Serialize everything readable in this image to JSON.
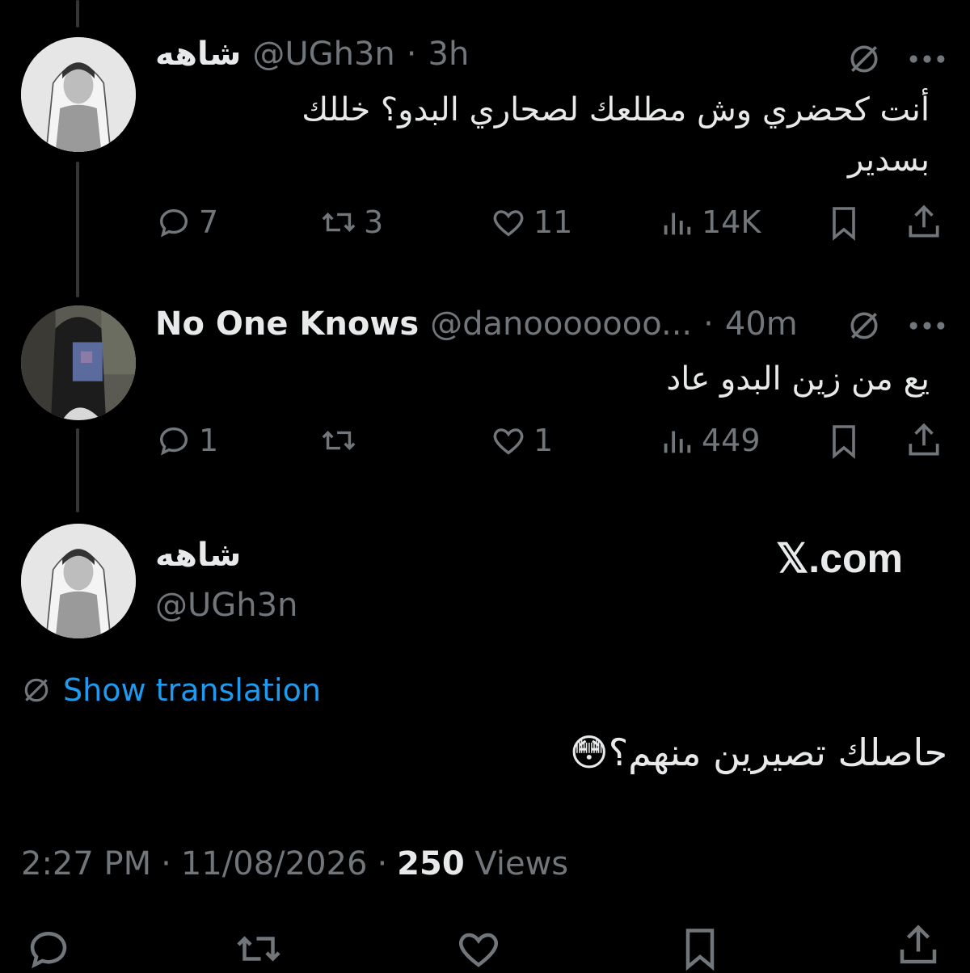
{
  "tweets": [
    {
      "name": "شاهه",
      "handle": "@UGh3n",
      "time": "3h",
      "text": "أنت كحضري وش مطلعك لصحاري البدو؟ خللك بسدير",
      "replies": "7",
      "retweets": "3",
      "likes": "11",
      "views": "14K"
    },
    {
      "name": "No One Knows",
      "handle": "@danooooooo...",
      "time": "40m",
      "text": "يع من زين البدو عاد",
      "replies": "1",
      "retweets": "",
      "likes": "1",
      "views": "449"
    }
  ],
  "main_tweet": {
    "name": "شاهه",
    "handle": "@UGh3n",
    "watermark": "𝕏.com",
    "show_translation": "Show translation",
    "text": "حاصلك تصيرين منهم؟😳",
    "time": "2:27 PM",
    "date": "11/08/2026",
    "views_count": "250",
    "views_label": "Views"
  },
  "separator": "·",
  "icons": [
    "reply-icon",
    "retweet-icon",
    "like-icon",
    "views-icon",
    "bookmark-icon",
    "share-icon",
    "grok-icon",
    "more-icon",
    "translate-icon"
  ],
  "colors": {
    "background": "#000000",
    "text": "#e7e9ea",
    "muted": "#71767b",
    "link": "#1d9bf0"
  }
}
